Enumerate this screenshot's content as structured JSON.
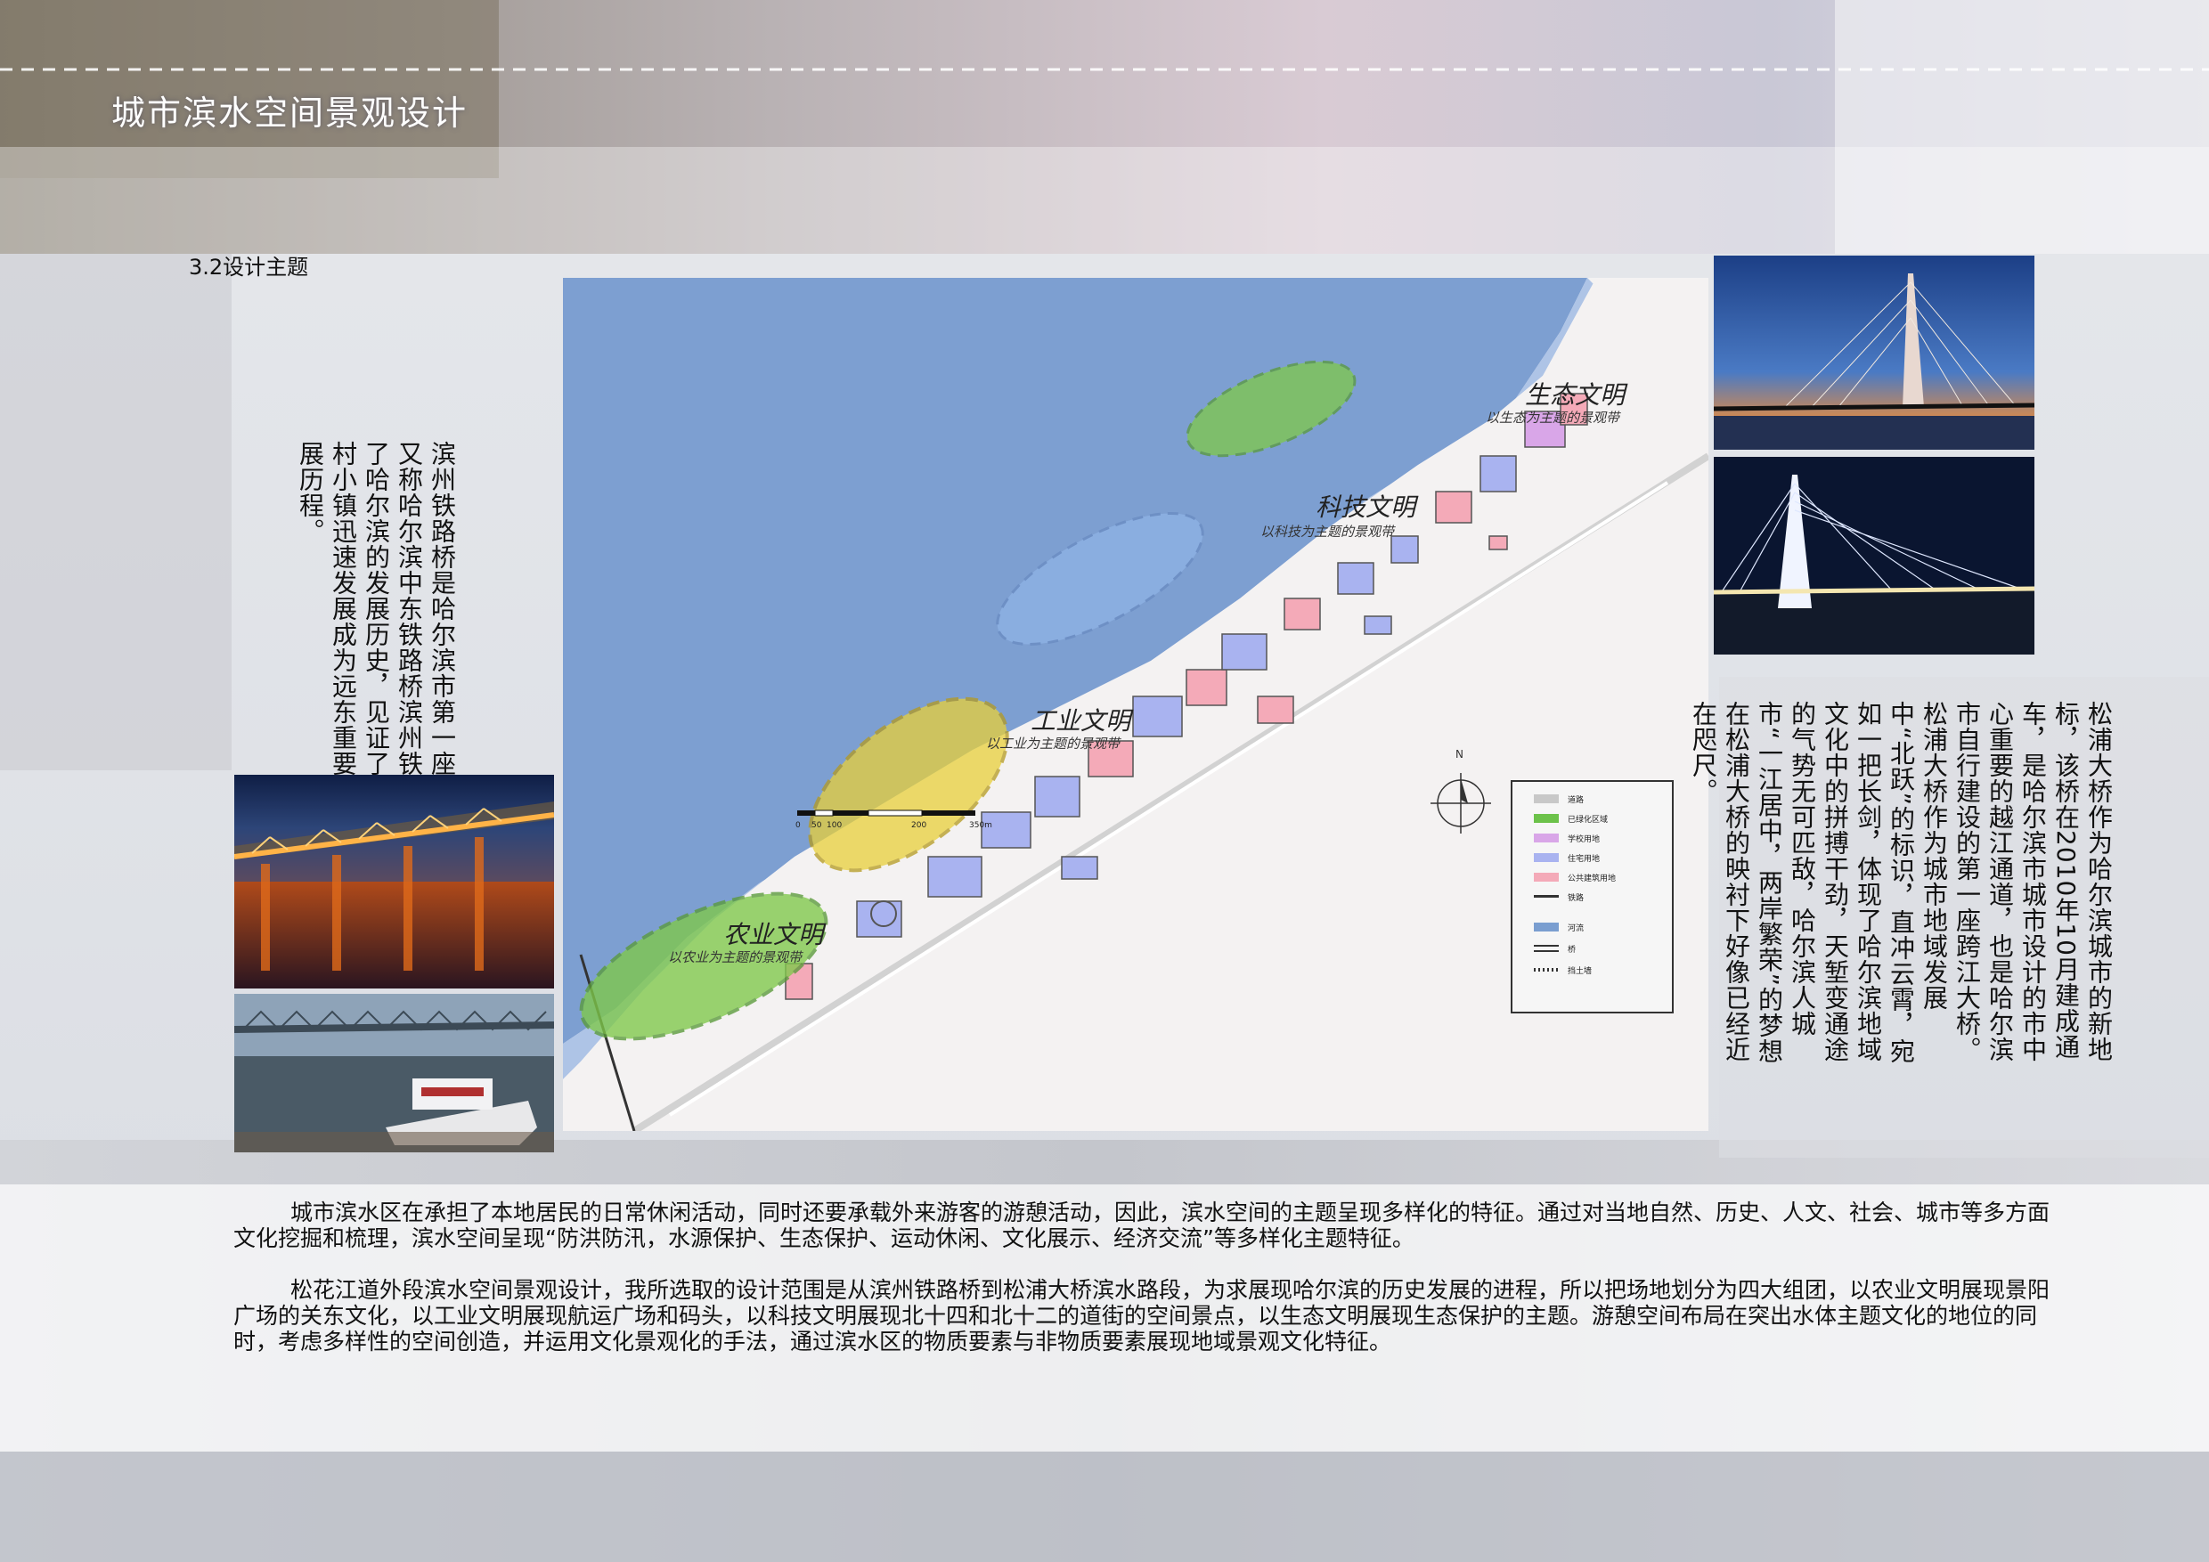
{
  "page": {
    "title": "城市滨水空间景观设计",
    "section": "3.2设计主题"
  },
  "left_text": "滨州铁路桥是哈尔滨市第一座跨江铁路桥，又称哈尔滨中东铁路桥滨州铁路桥。它见证了哈尔滨的发展历史，见证了城市由几个渔村小镇迅速发展成为远东重要经济中心的发展历程。",
  "right_text": "松浦大桥作为哈尔滨城市的新地标，该桥在2010年10月建成通车，是哈尔滨市城市设计的市中心重要的越江通道，也是哈尔滨市自行建设的第一座跨江大桥。松浦大桥作为城市地域发展中“北跃”的标识，直冲云霄，宛如一把长剑，体现了哈尔滨地域文化中的拼搏干劲，天堑变通途的气势无可匹敌，哈尔滨人城市“一江居中，两岸繁荣”的梦想在松浦大桥的映衬下好像已经近在咫尺。",
  "paragraphs": [
    "城市滨水区在承担了本地居民的日常休闲活动，同时还要承载外来游客的游憩活动，因此，滨水空间的主题呈现多样化的特征。通过对当地自然、历史、人文、社会、城市等多方面文化挖掘和梳理，滨水空间呈现“防洪防汛，水源保护、生态保护、运动休闲、文化展示、经济交流”等多样化主题特征。",
    "松花江道外段滨水空间景观设计，我所选取的设计范围是从滨州铁路桥到松浦大桥滨水路段，为求展现哈尔滨的历史发展的进程，所以把场地划分为四大组团，以农业文明展现景阳广场的关东文化，以工业文明展现航运广场和码头，以科技文明展现北十四和北十二的道街的空间景点，以生态文明展现生态保护的主题。游憩空间布局在突出水体主题文化的地位的同时，考虑多样性的空间创造，并运用文化景观化的手法，通过滨水区的物质要素与非物质要素展现地域景观文化特征。"
  ],
  "zones": [
    {
      "name": "农业文明",
      "sub": "以农业为主题的景观带",
      "color": "#7fc94a"
    },
    {
      "name": "工业文明",
      "sub": "以工业为主题的景观带",
      "color": "#e8d03a"
    },
    {
      "name": "科技文明",
      "sub": "以科技为主题的景观带",
      "color": "#8fb3e6"
    },
    {
      "name": "生态文明",
      "sub": "以生态为主题的景观带",
      "color": "#7fc94a"
    }
  ],
  "legend": {
    "items": [
      {
        "label": "道路",
        "color": "#c8c8c8"
      },
      {
        "label": "已绿化区域",
        "color": "#6cc24a"
      },
      {
        "label": "学校用地",
        "color": "#d9a6e8"
      },
      {
        "label": "住宅用地",
        "color": "#a9b3f0"
      },
      {
        "label": "公共建筑用地",
        "color": "#f4aab8"
      },
      {
        "label": "铁路",
        "color": "#333333"
      },
      {
        "label": "河流",
        "color": "#7a9ed0"
      },
      {
        "label": "桥",
        "color": "#333333"
      },
      {
        "label": "挡土墙",
        "color": "#333333"
      }
    ]
  },
  "scale": {
    "ticks": [
      "0",
      "50",
      "100",
      "200",
      "350m"
    ],
    "north": "N"
  }
}
